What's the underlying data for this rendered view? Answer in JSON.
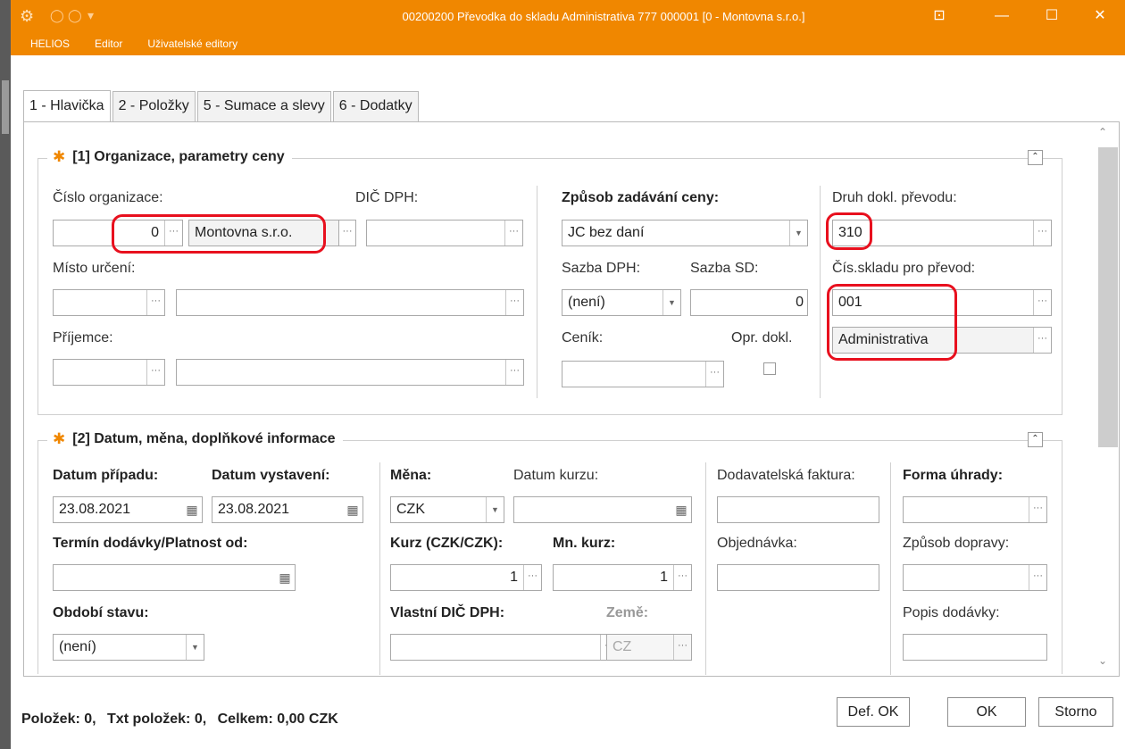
{
  "window": {
    "title": "00200200  Převodka do skladu Administrativa  777 000001 [0 - Montovna s.r.o.]",
    "minimize": "—",
    "maximize": "☐",
    "close": "✕",
    "pin": "⊡"
  },
  "menu": [
    "HELIOS",
    "Editor",
    "Uživatelské editory"
  ],
  "tabs": [
    "1 - Hlavička",
    "2 - Položky",
    "5 - Sumace a slevy",
    "6 - Dodatky"
  ],
  "section1": {
    "title": "[1] Organizace, parametry ceny",
    "cislo_organizace_label": "Číslo organizace:",
    "cislo_organizace_value": "0",
    "organizace_name": "Montovna s.r.o.",
    "dic_label": "DIČ DPH:",
    "dic_value": "",
    "misto_urceni_label": "Místo určení:",
    "prijemce_label": "Příjemce:",
    "zpusob_label": "Způsob zadávání ceny:",
    "zpusob_value": "JC bez daní",
    "sazba_dph_label": "Sazba DPH:",
    "sazba_dph_value": "(není)",
    "sazba_sd_label": "Sazba SD:",
    "sazba_sd_value": "0",
    "cenik_label": "Ceník:",
    "opr_dokl_label": "Opr. dokl.",
    "druh_label": "Druh dokl. převodu:",
    "druh_value": "310",
    "cis_skladu_label": "Čís.skladu pro převod:",
    "cis_skladu_value": "001",
    "sklad_name": "Administrativa"
  },
  "section2": {
    "title": "[2] Datum, měna, doplňkové informace",
    "datum_pripadu_label": "Datum případu:",
    "datum_pripadu_value": "23.08.2021",
    "datum_vystaveni_label": "Datum vystavení:",
    "datum_vystaveni_value": "23.08.2021",
    "termin_label": "Termín dodávky/Platnost od:",
    "obdobi_label": "Období stavu:",
    "obdobi_value": "(není)",
    "mena_label": "Měna:",
    "mena_value": "CZK",
    "datum_kurzu_label": "Datum kurzu:",
    "kurz_label": "Kurz (CZK/CZK):",
    "kurz_value": "1",
    "mn_kurz_label": "Mn. kurz:",
    "mn_kurz_value": "1",
    "vlastni_dic_label": "Vlastní DIČ DPH:",
    "zeme_label": "Země:",
    "zeme_value": "CZ",
    "dodavatelska_label": "Dodavatelská faktura:",
    "objednavka_label": "Objednávka:",
    "forma_uhrady_label": "Forma úhrady:",
    "zpusob_dopravy_label": "Způsob dopravy:",
    "popis_dodavky_label": "Popis dodávky:"
  },
  "status": {
    "polozek": "Položek: 0,",
    "txt_polozek": "Txt položek: 0,",
    "celkem": "Celkem: 0,00 CZK"
  },
  "buttons": {
    "def_ok": "Def. OK",
    "ok": "OK",
    "storno": "Storno"
  },
  "icons": {
    "dots": "···",
    "calendar": "▦",
    "drop": "▾",
    "collapse": "⌃",
    "star": "✱"
  },
  "colors": {
    "accent": "#f08700",
    "highlight": "#e8101e"
  }
}
